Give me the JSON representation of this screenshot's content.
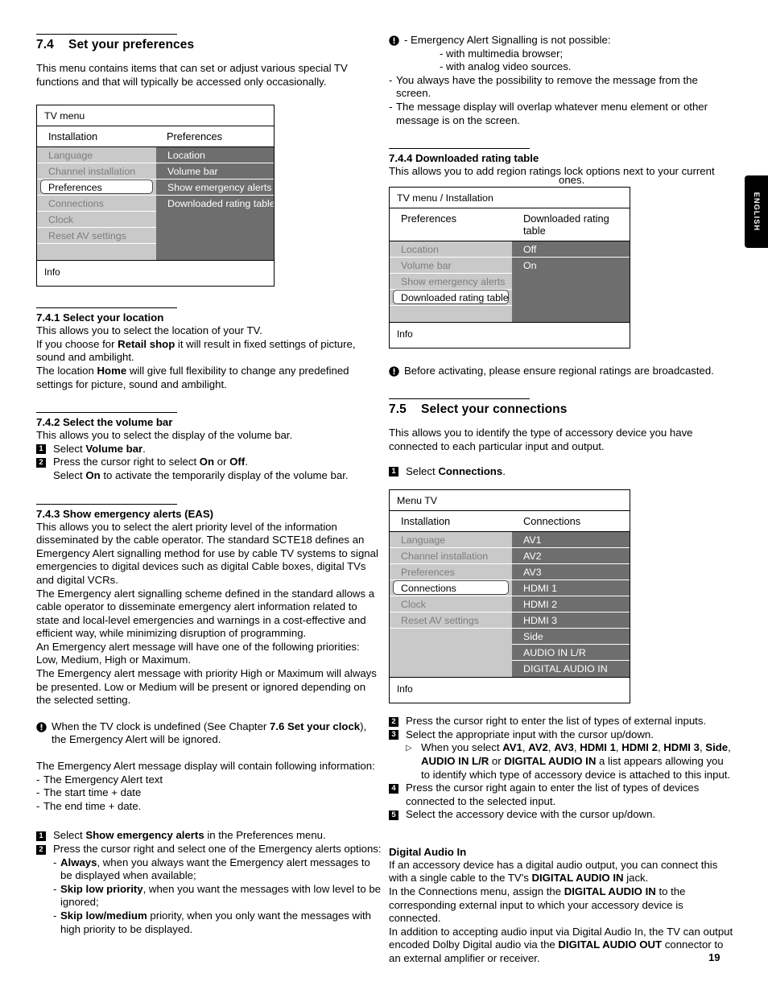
{
  "page": {
    "number": "19",
    "side_tab": "ENGLISH"
  },
  "left_column": {
    "section_74": {
      "number": "7.4",
      "title": "Set your preferences",
      "intro": "This menu contains items that can set or adjust various special TV functions and that will typically be accessed only occasionally."
    },
    "menu_preferences": {
      "title": "TV menu",
      "head_left": "Installation",
      "head_right": "Preferences",
      "left_items": [
        "Language",
        "Channel installation",
        "Preferences",
        "Connections",
        "Clock",
        "Reset AV settings"
      ],
      "selected_left": "Preferences",
      "right_items": [
        "Location",
        "Volume bar",
        "Show emergency alerts",
        "Downloaded rating table"
      ],
      "info": "Info"
    },
    "section_741": {
      "title": "7.4.1 Select your location",
      "p1": "This allows you to select the location of your TV.",
      "p2_a": "If you choose for ",
      "p2_b": "Retail shop",
      "p2_c": " it will result in fixed settings of picture, sound and ambilight.",
      "p3_a": "The location ",
      "p3_b": "Home",
      "p3_c": " will give full flexibility to change any predefined settings for picture, sound and ambilight."
    },
    "section_742": {
      "title": "7.4.2 Select the volume bar",
      "p1": "This allows you to select the display of the volume bar.",
      "step1_a": "Select ",
      "step1_b": "Volume bar",
      "step1_c": ".",
      "step2_a": "Press the cursor right to select ",
      "step2_b": "On",
      "step2_c": " or ",
      "step2_d": "Off",
      "step2_e": ".",
      "step2_line2_a": "Select ",
      "step2_line2_b": "On",
      "step2_line2_c": " to activate the temporarily display of the volume bar.",
      "num1": "1",
      "num2": "2"
    },
    "section_743": {
      "title": "7.4.3 Show emergency alerts (EAS)",
      "p1": "This allows you to select the alert priority level of the information disseminated by the cable operator. The standard SCTE18 defines an Emergency Alert signalling method for use by cable TV systems to signal emergencies to digital devices such as digital Cable boxes, digital TVs and digital VCRs.",
      "p2": "The Emergency alert signalling scheme defined in the standard allows a cable operator to disseminate emergency alert information related to state and local-level emergencies and warnings in a cost-effective and efficient way, while minimizing disruption of programming.",
      "p3": "An Emergency alert message will have one of the following priorities: Low, Medium, High or Maximum.",
      "p4": "The Emergency alert message with priority High or Maximum will always be presented. Low or Medium will be present or ignored depending on the selected setting.",
      "note_a": "When the TV clock is undefined (See Chapter ",
      "note_b": "7.6 Set your clock",
      "note_c": "), the Emergency Alert will be ignored.",
      "p5": "The Emergency Alert message display will contain following information:",
      "bullets": [
        "The Emergency Alert text",
        "The start time + date",
        "The end time + date."
      ],
      "step1_a": "Select ",
      "step1_b": "Show emergency alerts",
      "step1_c": " in the Preferences menu.",
      "step2": "Press the cursor right and select one of the Emergency alerts options:",
      "options": [
        {
          "bold": "Always",
          "rest": ", when you always want the Emergency alert messages to be displayed when available;"
        },
        {
          "bold": "Skip low priority",
          "rest": ", when you want the messages with low level to be ignored;"
        },
        {
          "bold": "Skip low/medium",
          "rest": " priority, when you only want the messages with high priority to be displayed."
        }
      ],
      "num1": "1",
      "num2": "2"
    }
  },
  "right_column": {
    "note_top": {
      "line1": "- Emergency Alert Signalling is not possible:",
      "sub1": "- with multimedia browser;",
      "sub2": "- with analog video sources.",
      "line2": "You always have the possibility to remove the message from the screen.",
      "line3": "The message display will overlap whatever menu element or other message is on the screen."
    },
    "section_744": {
      "title": "7.4.4 Downloaded rating table",
      "p1": "This allows you to add region ratings lock options next to your current",
      "p1_wrap": "ones."
    },
    "menu_rating": {
      "title": "TV menu / Installation",
      "head_left": "Preferences",
      "head_right": "Downloaded rating table",
      "left_items": [
        "Location",
        "Volume bar",
        "Show emergency alerts",
        "Downloaded rating table"
      ],
      "selected_left": "Downloaded rating table",
      "right_items": [
        "Off",
        "On"
      ],
      "info": "Info"
    },
    "note_rating": "Before activating, please ensure regional ratings are broadcasted.",
    "section_75": {
      "number": "7.5",
      "title": "Select your connections",
      "intro": "This allows you to identify the type of accessory device you have connected to each particular input and output.",
      "step1_a": "Select ",
      "step1_b": "Connections",
      "step1_c": ".",
      "num1": "1"
    },
    "menu_connections": {
      "title": "Menu TV",
      "head_left": "Installation",
      "head_right": "Connections",
      "left_items": [
        "Language",
        "Channel installation",
        "Preferences",
        "Connections",
        "Clock",
        "Reset AV settings"
      ],
      "selected_left": "Connections",
      "right_items": [
        "AV1",
        "AV2",
        "AV3",
        "HDMI 1",
        "HDMI 2",
        "HDMI 3",
        "Side",
        "AUDIO IN L/R",
        "DIGITAL AUDIO IN"
      ],
      "info": "Info"
    },
    "steps": {
      "num2": "2",
      "step2": "Press the cursor right to enter the list of types of external inputs.",
      "num3": "3",
      "step3": "Select the appropriate input with the cursor up/down.",
      "arrow_a": "When you select ",
      "arrow_b": "AV1",
      "arrow_c": ", ",
      "arrow_d": "AV2",
      "arrow_e": ", ",
      "arrow_f": "AV3",
      "arrow_g": ", ",
      "arrow_h": "HDMI 1",
      "arrow_i": ", ",
      "arrow_j": "HDMI 2",
      "arrow_k": ", ",
      "arrow_l": "HDMI 3",
      "arrow_m": ", ",
      "arrow_n": "Side",
      "arrow_o": ", ",
      "arrow_p": "AUDIO IN L/R",
      "arrow_q": " or ",
      "arrow_r": "DIGITAL AUDIO IN",
      "arrow_s": " a list appears allowing you to identify which type of accessory device is attached to this input.",
      "num4": "4",
      "step4": "Press the cursor right again to enter the list of types of devices connected to the selected input.",
      "num5": "5",
      "step5": "Select the accessory device with the cursor up/down."
    },
    "digital_audio_in": {
      "title": "Digital Audio In",
      "p1_a": "If an accessory device has a digital audio output, you can connect this with a single cable to the TV's ",
      "p1_b": "DIGITAL AUDIO IN",
      "p1_c": " jack.",
      "p2_a": "In the Connections menu, assign the ",
      "p2_b": "DIGITAL AUDIO IN",
      "p2_c": " to the corresponding external input to which your accessory device is connected.",
      "p3_a": "In addition to accepting audio input via Digital Audio In, the TV can output encoded Dolby Digital audio via the ",
      "p3_b": "DIGITAL AUDIO OUT",
      "p3_c": " connector to an external amplifier or receiver."
    }
  },
  "colors": {
    "pane_left_bg": "#c9c9c9",
    "pane_right_bg": "#6e6e6e",
    "pane_left_text": "#7d7d7d",
    "pane_right_text": "#ffffff",
    "tab_bg": "#000000"
  }
}
